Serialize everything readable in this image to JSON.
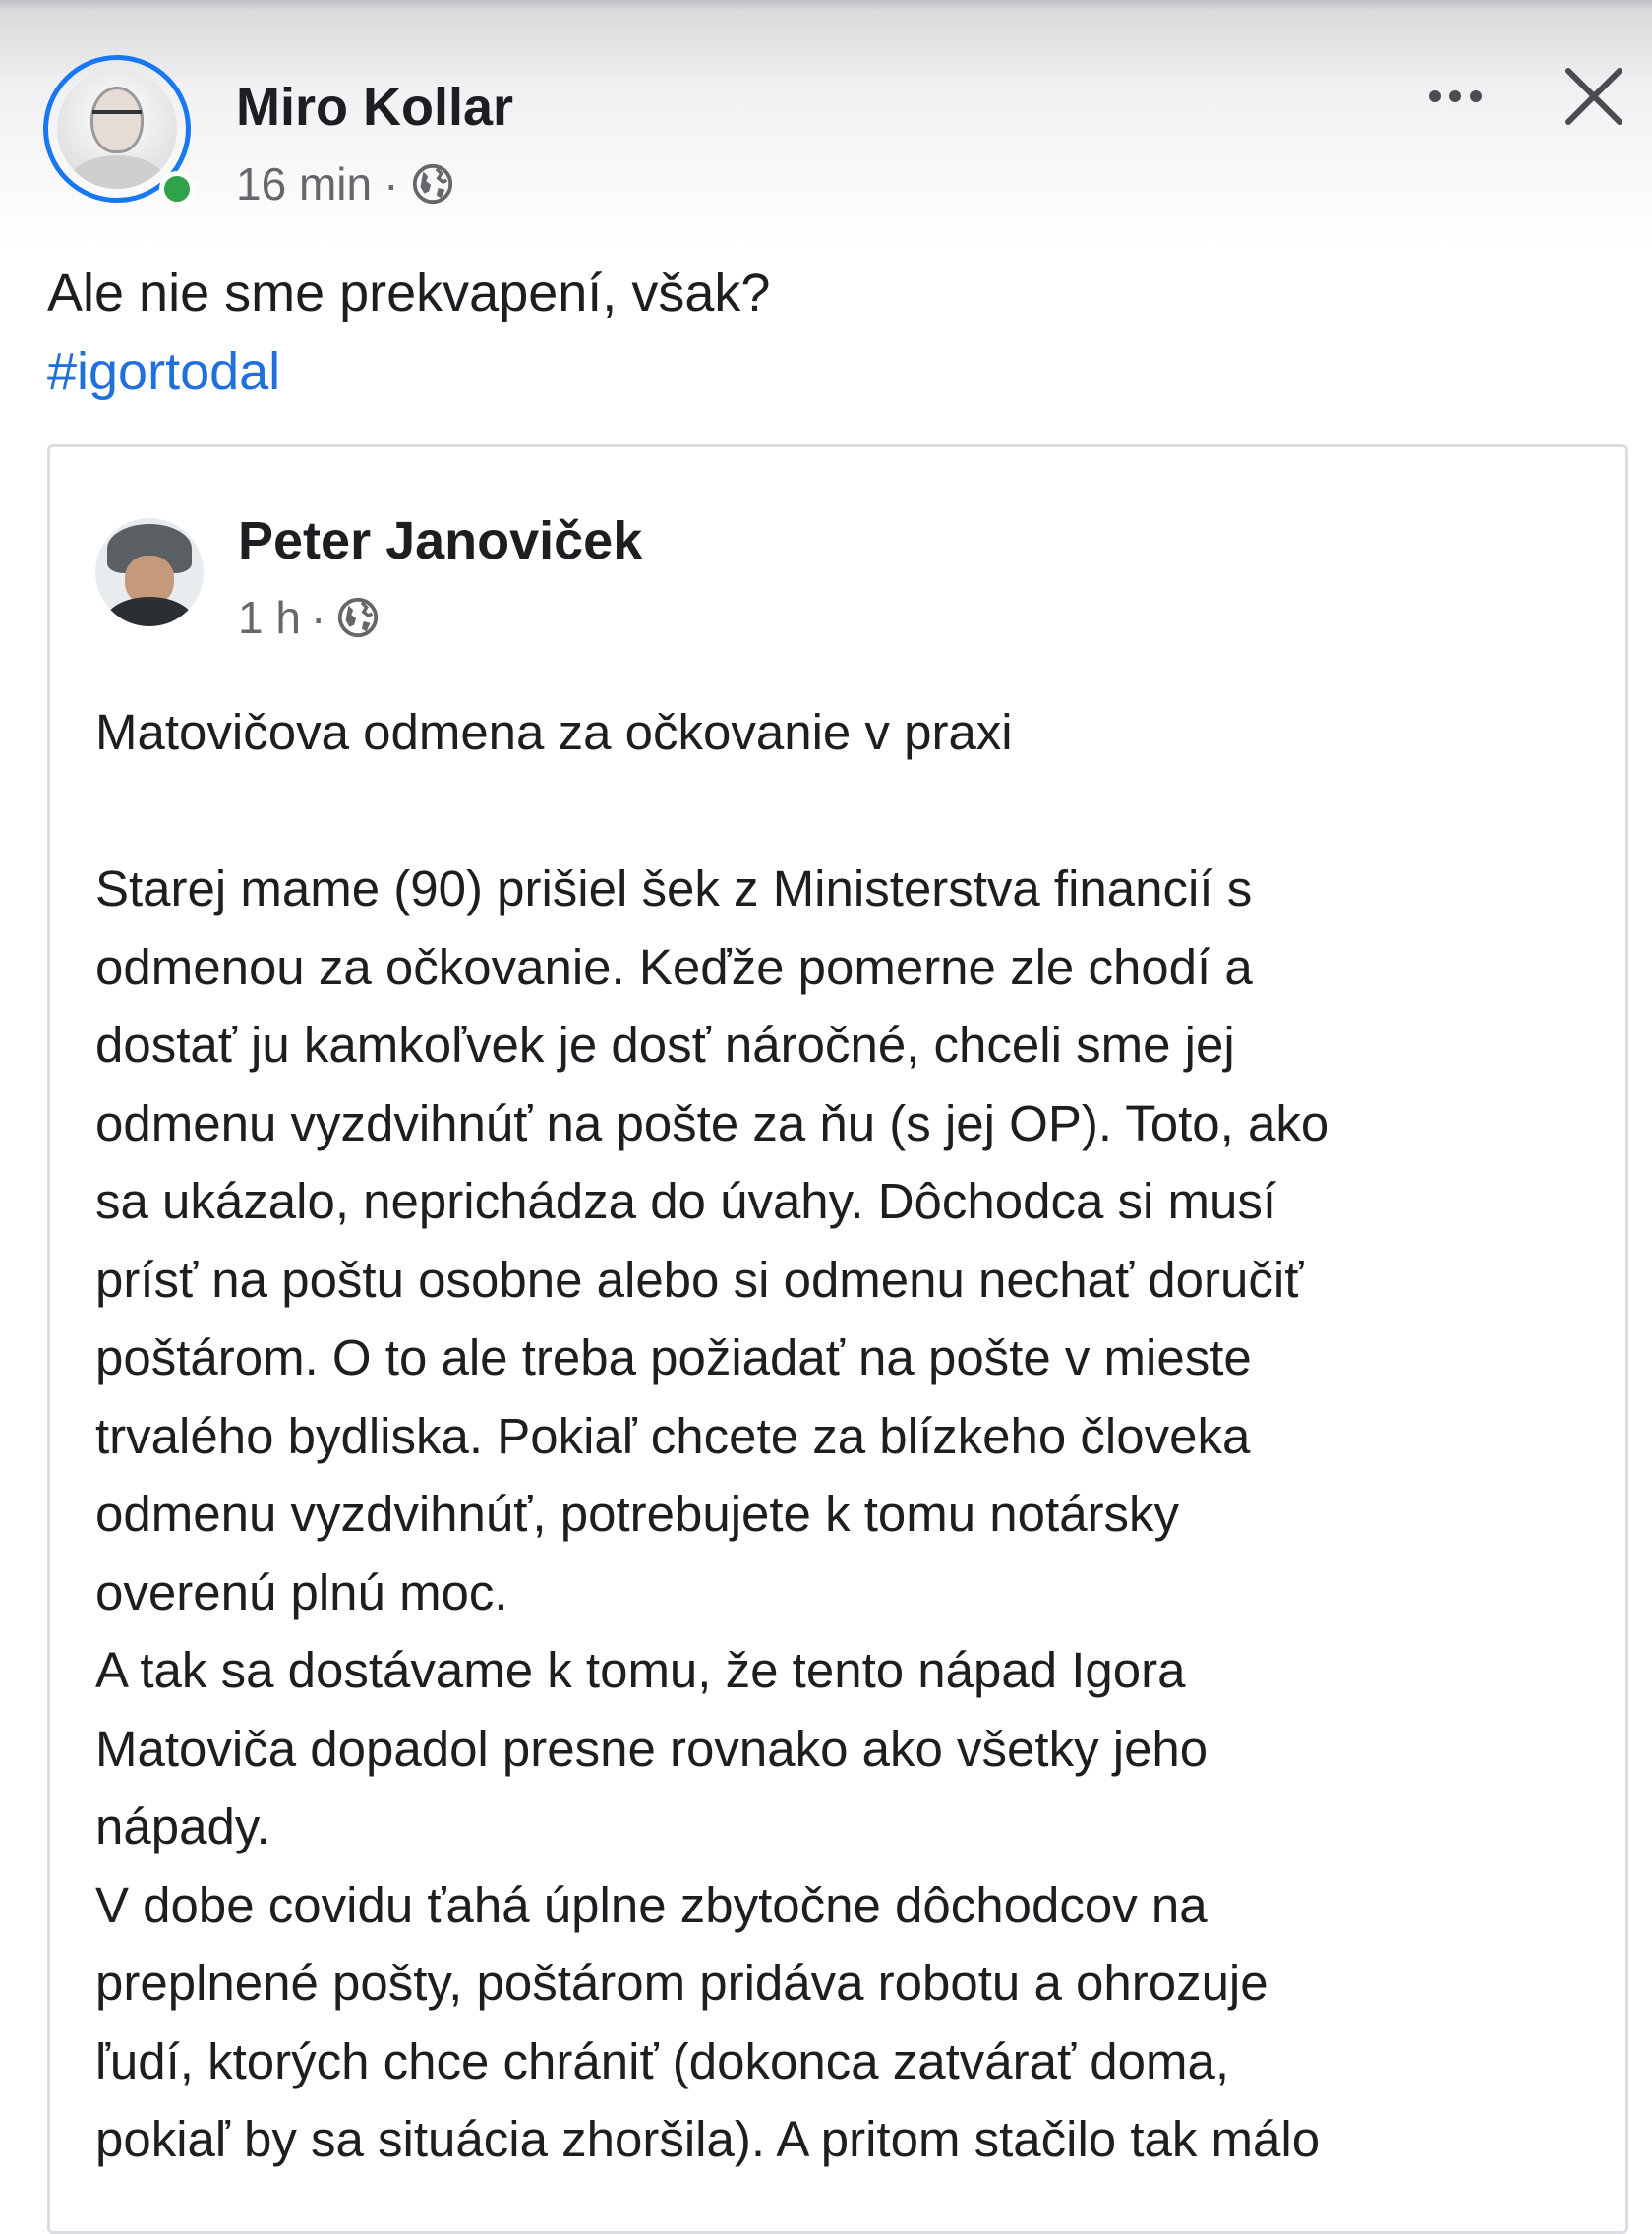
{
  "post": {
    "author": "Miro Kollar",
    "time": "16 min",
    "separator": "·",
    "text": "Ale nie sme prekvapení, však?",
    "hashtag": "#igortodal"
  },
  "shared_post": {
    "author": "Peter Janoviček",
    "time": "1 h",
    "separator": "·",
    "title": "Matovičova odmena za očkovanie v praxi",
    "paragraphs": [
      "Starej mame (90) prišiel šek z Ministerstva financií s\nodmenou za očkovanie. Keďže pomerne zle chodí a\ndostať ju kamkoľvek je dosť náročné, chceli sme jej\nodmenu vyzdvihnúť na pošte za ňu (s jej OP). Toto, ako\nsa ukázalo, neprichádza do úvahy. Dôchodca si musí\nprísť na poštu osobne alebo si odmenu nechať doručiť\npoštárom. O to ale treba požiadať na pošte v mieste\ntrvalého bydliska. Pokiaľ chcete za blízkeho človeka\nodmenu vyzdvihnúť, potrebujete k tomu notársky\noverenú plnú moc.",
      "A tak sa dostávame k tomu, že tento nápad Igora\nMatoviča dopadol presne rovnako ako všetky jeho\nnápady.",
      "V dobe covidu ťahá úplne zbytočne dôchodcov na\npreplnené pošty, poštárom pridáva robotu a ohrozuje\nľudí, ktorých chce chrániť (dokonca zatvárať doma,\npokiaľ by sa situácia zhoršila). A pritom stačilo tak málo"
    ]
  },
  "icons": {
    "more": "more-horizontal-icon",
    "close": "close-icon",
    "audience": "globe-icon"
  },
  "colors": {
    "link": "#216fdb",
    "story_ring": "#1877f2",
    "online": "#31a24c",
    "meta_text": "#65676b"
  }
}
